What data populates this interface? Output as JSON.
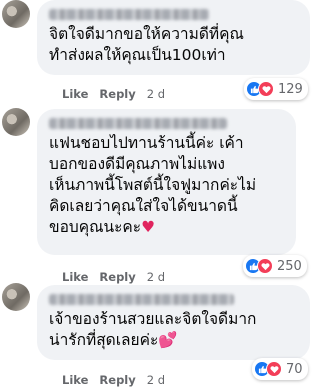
{
  "actions": {
    "like": "Like",
    "reply": "Reply"
  },
  "comments": [
    {
      "text": "จิตใจดีมากขอให้ความดีที่คุณ\nทำส่งผลให้คุณเป็น100เท่า",
      "time": "2 d",
      "reaction_count": "129",
      "reactions": [
        "like-icon",
        "love-icon"
      ]
    },
    {
      "text": "แฟนชอบไปทานร้านนี้ค่ะ เค้า\nบอกของดีมีคุณภาพไม่แพง\nเห็นภาพนี้โพสต์นี้ใจฟูมากค่ะไม่\nคิดเลยว่าคุณใส่ใจได้ขนาดนี้\nขอบคุณนะคะ",
      "emoji": "♥",
      "time": "2 d",
      "reaction_count": "250",
      "reactions": [
        "like-icon",
        "love-icon"
      ]
    },
    {
      "text": "เจ้าของร้านสวยและจิตใจดีมาก\nน่ารักที่สุดเลยค่ะ",
      "emoji": "💕",
      "time": "2 d",
      "reaction_count": "70",
      "reactions": [
        "like-icon",
        "love-icon"
      ]
    }
  ],
  "colors": {
    "bubble": "#f0f2f5",
    "like": "#1877f2",
    "love": "#f33e58",
    "meta": "#65676b"
  }
}
